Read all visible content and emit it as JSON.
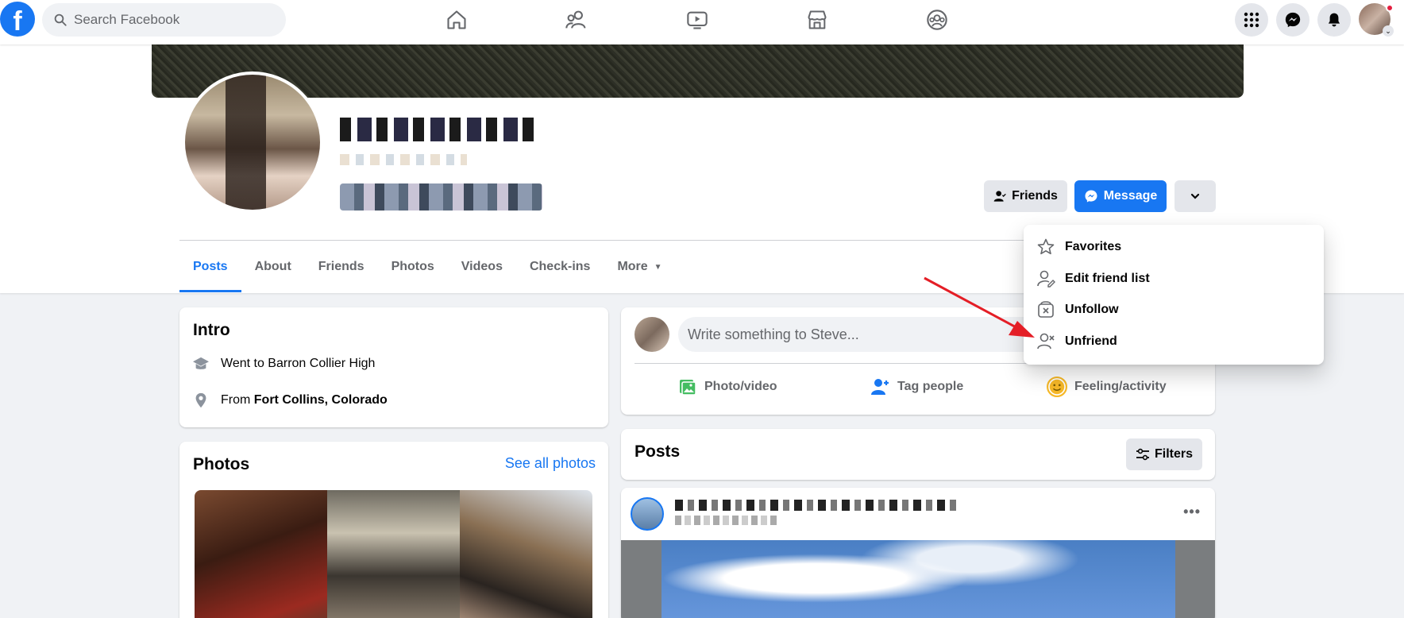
{
  "topbar": {
    "logo_letter": "f",
    "search_placeholder": "Search Facebook",
    "nav_icons": [
      "home-icon",
      "friends-icon",
      "watch-icon",
      "marketplace-icon",
      "groups-icon"
    ],
    "right_icons": [
      "menu-grid-icon",
      "messenger-icon",
      "notifications-icon"
    ]
  },
  "profile": {
    "actions": {
      "friends_label": "Friends",
      "message_label": "Message"
    },
    "tabs": [
      "Posts",
      "About",
      "Friends",
      "Photos",
      "Videos",
      "Check-ins",
      "More"
    ],
    "active_tab": "Posts"
  },
  "menu": {
    "items": [
      {
        "label": "Favorites",
        "icon": "star-icon"
      },
      {
        "label": "Edit friend list",
        "icon": "edit-friend-list-icon"
      },
      {
        "label": "Unfollow",
        "icon": "unfollow-icon"
      },
      {
        "label": "Unfriend",
        "icon": "unfriend-icon"
      }
    ]
  },
  "intro": {
    "title": "Intro",
    "education": "Went to Barron Collier High",
    "from_prefix": "From",
    "from_place": "Fort Collins, Colorado"
  },
  "photos": {
    "title": "Photos",
    "see_all": "See all photos"
  },
  "composer": {
    "placeholder": "Write something to Steve...",
    "actions": [
      {
        "label": "Photo/video",
        "icon": "photo-video-icon",
        "color": "#45bd62"
      },
      {
        "label": "Tag people",
        "icon": "tag-people-icon",
        "color": "#1877f2"
      },
      {
        "label": "Feeling/activity",
        "icon": "feeling-icon",
        "color": "#f7b928"
      }
    ]
  },
  "posts": {
    "title": "Posts",
    "filters_label": "Filters"
  },
  "colors": {
    "accent": "#1877f2",
    "annotation_arrow": "#e41e26"
  }
}
